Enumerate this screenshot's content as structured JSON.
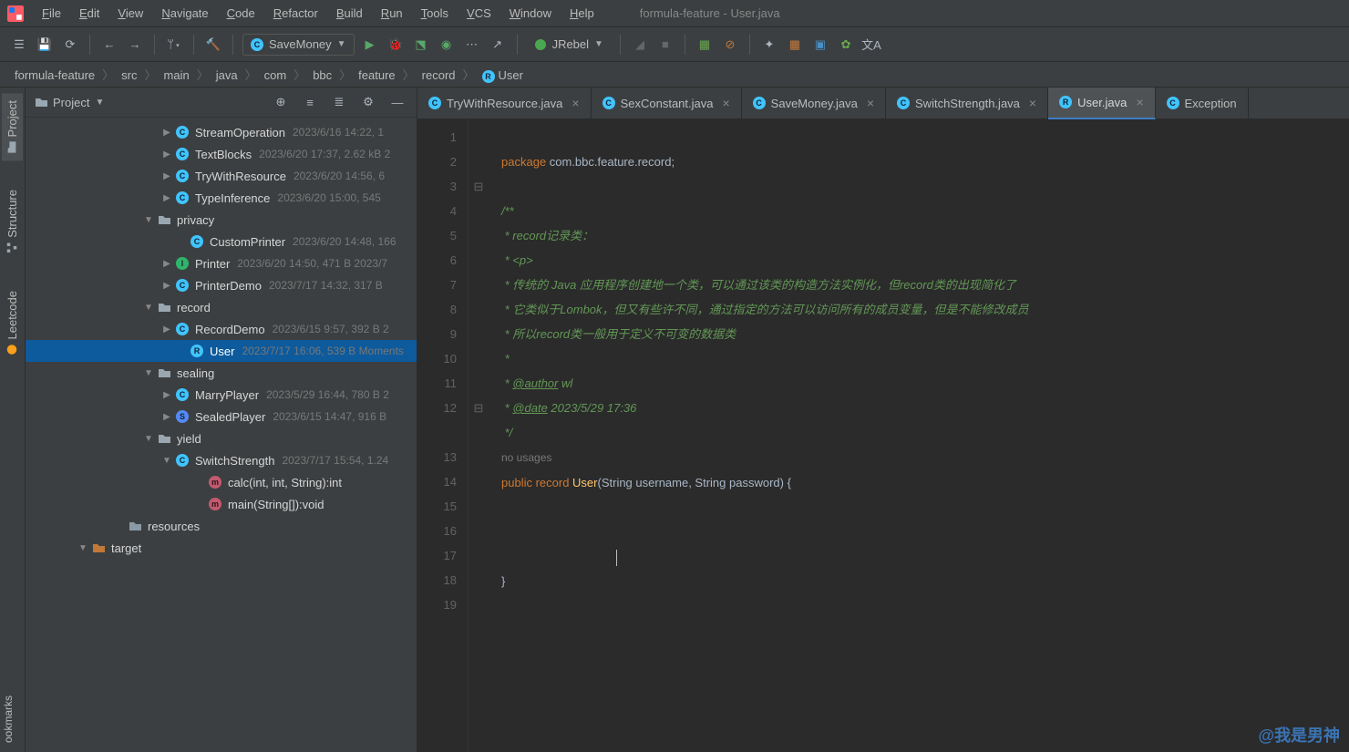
{
  "window": {
    "title": "formula-feature - User.java"
  },
  "menu": [
    "File",
    "Edit",
    "View",
    "Navigate",
    "Code",
    "Refactor",
    "Build",
    "Run",
    "Tools",
    "VCS",
    "Window",
    "Help"
  ],
  "toolbar": {
    "run_config": "SaveMoney",
    "jrebel": "JRebel"
  },
  "breadcrumbs": [
    "formula-feature",
    "src",
    "main",
    "java",
    "com",
    "bbc",
    "feature",
    "record",
    "User"
  ],
  "sidebar_tabs": {
    "project": "Project",
    "structure": "Structure",
    "leetcode": "Leetcode",
    "bookmarks": "ookmarks"
  },
  "panel": {
    "title": "Project"
  },
  "tree": [
    {
      "indent": 148,
      "arrow": "▶",
      "icon": "class",
      "label": "StreamOperation",
      "meta": "2023/6/16 14:22, 1"
    },
    {
      "indent": 148,
      "arrow": "▶",
      "icon": "class",
      "label": "TextBlocks",
      "meta": "2023/6/20 17:37, 2.62 kB 2"
    },
    {
      "indent": 148,
      "arrow": "▶",
      "icon": "class",
      "label": "TryWithResource",
      "meta": "2023/6/20 14:56, 6"
    },
    {
      "indent": 148,
      "arrow": "▶",
      "icon": "class",
      "label": "TypeInference",
      "meta": "2023/6/20 15:00, 545"
    },
    {
      "indent": 128,
      "arrow": "▼",
      "icon": "folder",
      "label": "privacy",
      "meta": ""
    },
    {
      "indent": 164,
      "arrow": "",
      "icon": "class",
      "label": "CustomPrinter",
      "meta": "2023/6/20 14:48, 166"
    },
    {
      "indent": 148,
      "arrow": "▶",
      "icon": "iface",
      "label": "Printer",
      "meta": "2023/6/20 14:50, 471 B 2023/7"
    },
    {
      "indent": 148,
      "arrow": "▶",
      "icon": "class",
      "label": "PrinterDemo",
      "meta": "2023/7/17 14:32, 317 B"
    },
    {
      "indent": 128,
      "arrow": "▼",
      "icon": "folder",
      "label": "record",
      "meta": ""
    },
    {
      "indent": 148,
      "arrow": "▶",
      "icon": "class",
      "label": "RecordDemo",
      "meta": "2023/6/15 9:57, 392 B 2"
    },
    {
      "indent": 164,
      "arrow": "",
      "icon": "record",
      "label": "User",
      "meta": "2023/7/17 16:06, 539 B Moments",
      "selected": true
    },
    {
      "indent": 128,
      "arrow": "▼",
      "icon": "folder",
      "label": "sealing",
      "meta": ""
    },
    {
      "indent": 148,
      "arrow": "▶",
      "icon": "class",
      "label": "MarryPlayer",
      "meta": "2023/5/29 16:44, 780 B 2"
    },
    {
      "indent": 148,
      "arrow": "▶",
      "icon": "sealed",
      "label": "SealedPlayer",
      "meta": "2023/6/15 14:47, 916 B"
    },
    {
      "indent": 128,
      "arrow": "▼",
      "icon": "folder",
      "label": "yield",
      "meta": ""
    },
    {
      "indent": 148,
      "arrow": "▼",
      "icon": "class",
      "label": "SwitchStrength",
      "meta": "2023/7/17 15:54, 1.24"
    },
    {
      "indent": 184,
      "arrow": "",
      "icon": "method",
      "label": "calc(int, int, String):int",
      "meta": ""
    },
    {
      "indent": 184,
      "arrow": "",
      "icon": "method",
      "label": "main(String[]):void",
      "meta": ""
    },
    {
      "indent": 96,
      "arrow": "",
      "icon": "resfolder",
      "label": "resources",
      "meta": ""
    },
    {
      "indent": 56,
      "arrow": "▼",
      "icon": "tfolder",
      "label": "target",
      "meta": ""
    }
  ],
  "tabs": [
    {
      "label": "TryWithResource.java",
      "icon": "class",
      "active": false
    },
    {
      "label": "SexConstant.java",
      "icon": "class",
      "active": false
    },
    {
      "label": "SaveMoney.java",
      "icon": "class",
      "active": false
    },
    {
      "label": "SwitchStrength.java",
      "icon": "class",
      "active": false
    },
    {
      "label": "User.java",
      "icon": "record",
      "active": true
    },
    {
      "label": "Exception",
      "icon": "class",
      "active": false,
      "noclose": true
    }
  ],
  "code": {
    "lines": [
      1,
      2,
      3,
      4,
      5,
      6,
      7,
      8,
      9,
      10,
      11,
      12,
      "",
      13,
      14,
      15,
      16,
      17,
      18,
      19
    ],
    "pkg_kw": "package ",
    "pkg": "com.bbc.feature.record",
    "c_open": "/**",
    "c1": " * record记录类：",
    "c2": " * <p>",
    "c3": " * 传统的 Java 应用程序创建地一个类，可以通过该类的构造方法实例化，但record类的出现简化了",
    "c4": " * 它类似于Lombok，但又有些许不同，通过指定的方法可以访问所有的成员变量，但是不能修改成员",
    "c5": " * 所以record类一般用于定义不可变的数据类",
    "c6": " *",
    "author_tag": "@author",
    "author_val": " wl",
    "date_tag": "@date",
    "date_val": " 2023/5/29 17:36",
    "c_close": " */",
    "hint": "no usages",
    "pub": "public ",
    "rec": "record ",
    "cls": "User",
    "sig": "(String username, String password) {",
    "brace_close": "}"
  },
  "watermark": "@我是男神"
}
